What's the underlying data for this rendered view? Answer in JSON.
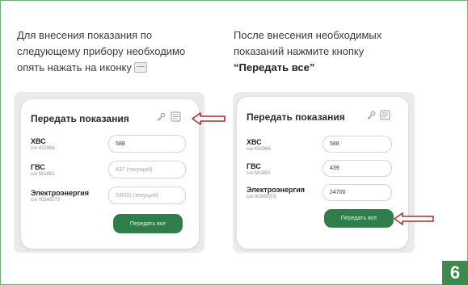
{
  "left_instruction": {
    "line1": "Для внесения показания по",
    "line2": "следующему прибору необходимо",
    "line3": "опять нажать на иконку"
  },
  "right_instruction": {
    "line1": "После внесения необходимых",
    "line2": "показаний нажмите кнопку",
    "line3": "“Передать все”"
  },
  "left_card": {
    "title": "Передать показания",
    "rows": [
      {
        "name": "ХВС",
        "sub": "с/н 432966",
        "value": "588",
        "placeholder": false
      },
      {
        "name": "ГВС",
        "sub": "с/н 581891",
        "value": "437 (текущий)",
        "placeholder": true
      },
      {
        "name": "Электроэнергия",
        "sub": "с/н 00345073",
        "value": "24000 (текущий)",
        "placeholder": true
      }
    ],
    "button": "Передать все"
  },
  "right_card": {
    "title": "Передать показания",
    "rows": [
      {
        "name": "ХВС",
        "sub": "с/н 432966",
        "value": "588",
        "placeholder": false
      },
      {
        "name": "ГВС",
        "sub": "с/н 581891",
        "value": "439",
        "placeholder": false
      },
      {
        "name": "Электроэнергия",
        "sub": "с/н 00345073",
        "value": "24700",
        "placeholder": false
      }
    ],
    "button": "Передать все"
  },
  "badge": "6",
  "colors": {
    "button": "#2e7d4a",
    "arrow": "#b02e2e",
    "badge": "#3c8b4c",
    "border": "#6fae7a"
  },
  "icons": {
    "key": "key-icon",
    "doc": "document-icon",
    "arrow": "arrow-left-icon"
  }
}
